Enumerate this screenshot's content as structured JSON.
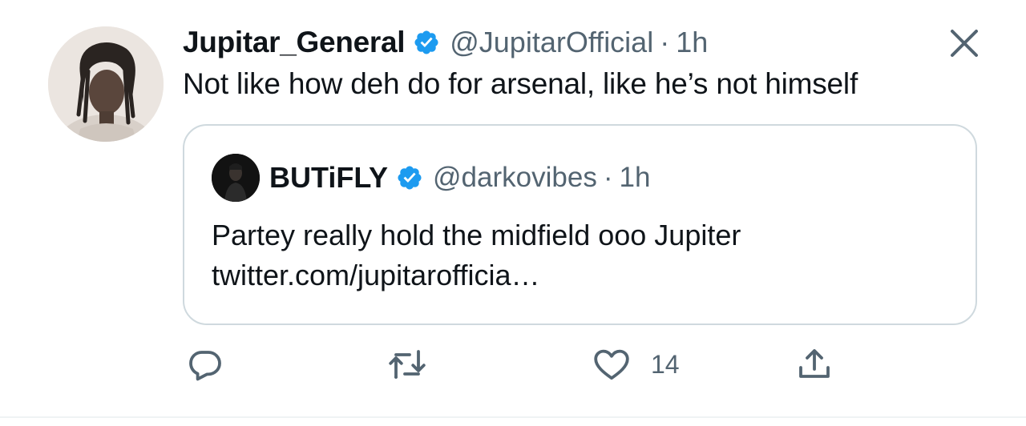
{
  "tweet": {
    "author": {
      "display_name": "Jupitar_General",
      "handle": "@JupitarOfficial",
      "verified": true,
      "avatar_icon": "user-photo-avatar"
    },
    "separator": "·",
    "time": "1h",
    "text": "Not like how deh do for arsenal, like he’s not himself",
    "close_icon": "close-icon"
  },
  "quote": {
    "author": {
      "display_name": "BUTiFLY",
      "handle": "@darkovibes",
      "verified": true,
      "avatar_icon": "user-photo-avatar"
    },
    "separator": "·",
    "time": "1h",
    "text_lines": [
      "Partey really hold the midfield ooo Jupiter",
      "twitter.com/jupitarofficia…"
    ]
  },
  "actions": {
    "reply": {
      "icon": "reply-icon"
    },
    "retweet": {
      "icon": "retweet-icon"
    },
    "like": {
      "icon": "heart-icon",
      "count": "14"
    },
    "share": {
      "icon": "share-icon"
    }
  },
  "colors": {
    "text_primary": "#0f1419",
    "text_secondary": "#536471",
    "verified_blue": "#1d9bf0",
    "border": "#cfd9de"
  }
}
